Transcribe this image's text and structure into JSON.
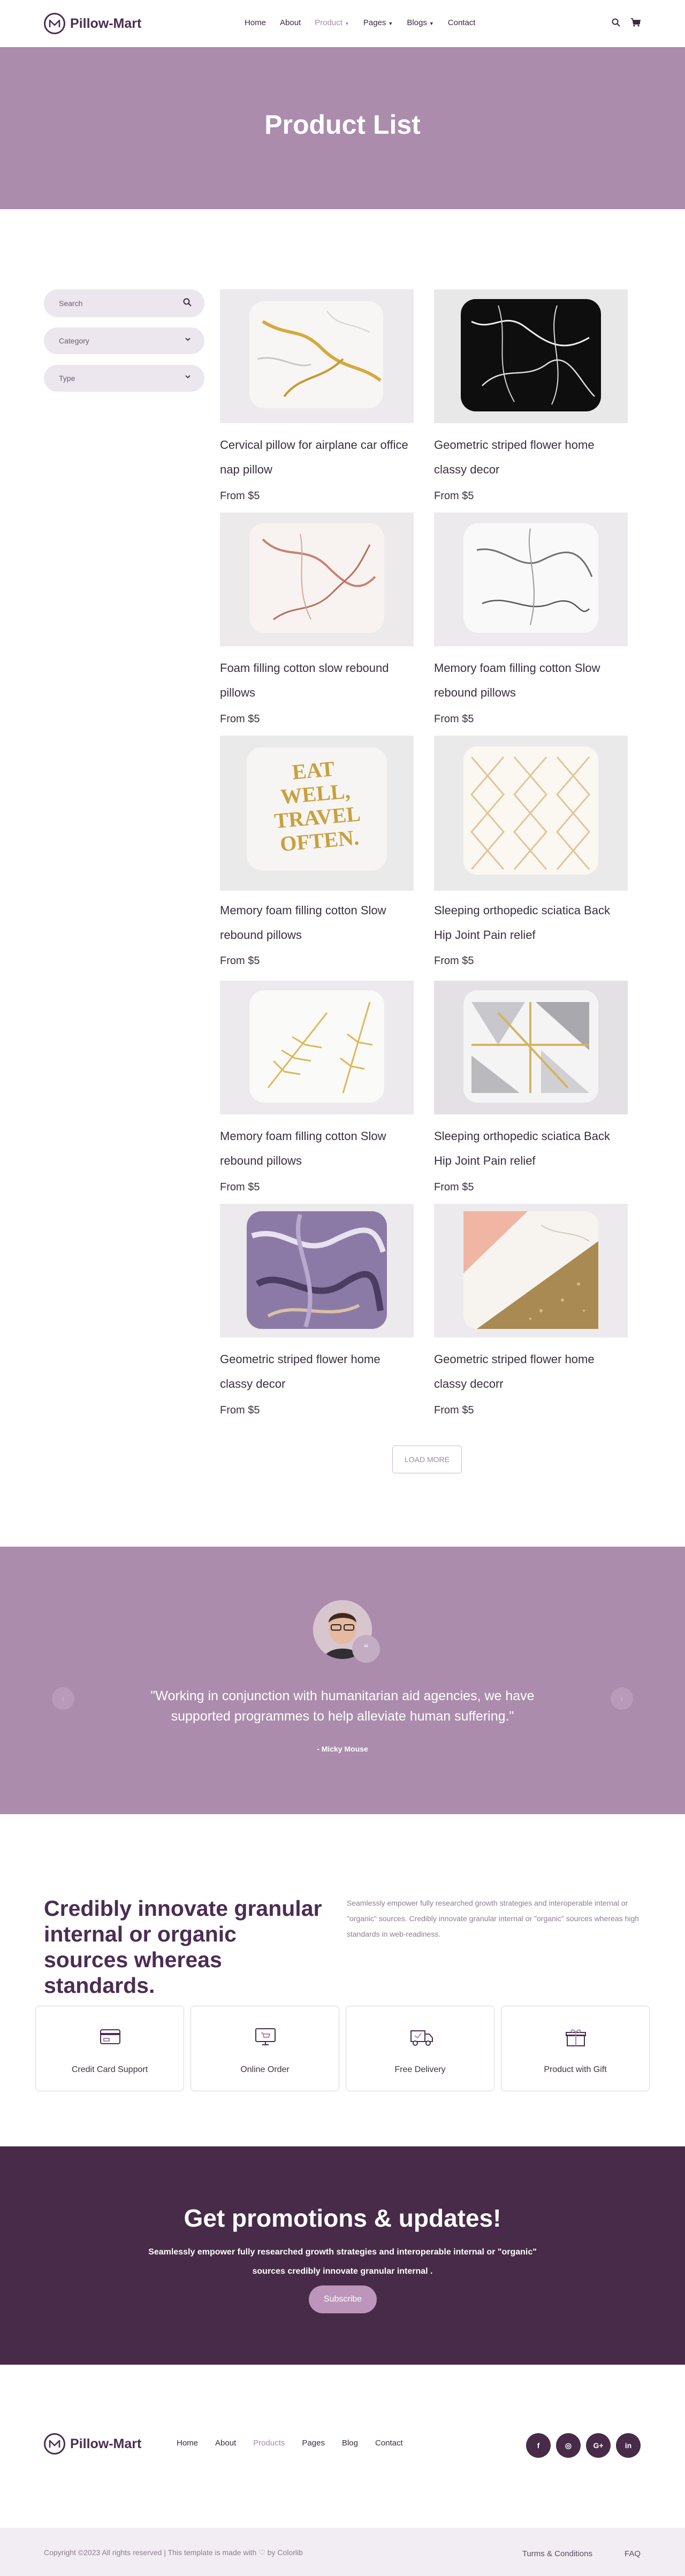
{
  "brand": {
    "name": "Pillow-Mart",
    "accent": "#ab8cac",
    "dark": "#472b48"
  },
  "nav": {
    "items": [
      {
        "label": "Home"
      },
      {
        "label": "About"
      },
      {
        "label": "Product",
        "active": true,
        "dropdown": true
      },
      {
        "label": "Pages",
        "dropdown": true
      },
      {
        "label": "Blogs",
        "dropdown": true
      },
      {
        "label": "Contact"
      }
    ],
    "icons": [
      "search-icon",
      "cart-icon"
    ]
  },
  "hero": {
    "title": "Product List"
  },
  "filters": {
    "search_placeholder": "Search",
    "category_label": "Category",
    "type_label": "Type"
  },
  "products": [
    {
      "title": "Cervical pillow for airplane car office nap pillow",
      "price": "From $5"
    },
    {
      "title": "Geometric striped flower home classy decor",
      "price": "From $5"
    },
    {
      "title": "Foam filling cotton slow rebound pillows",
      "price": "From $5"
    },
    {
      "title": "Memory foam filling cotton Slow rebound pillows",
      "price": "From $5"
    },
    {
      "title": "Memory foam filling cotton Slow rebound pillows",
      "price": "From $5"
    },
    {
      "title": "Sleeping orthopedic sciatica Back Hip Joint Pain relief",
      "price": "From $5"
    },
    {
      "title": "Memory foam filling cotton Slow rebound pillows",
      "price": "From $5"
    },
    {
      "title": "Sleeping orthopedic sciatica Back Hip Joint Pain relief",
      "price": "From $5"
    },
    {
      "title": "Geometric striped flower home classy decor",
      "price": "From $5"
    },
    {
      "title": "Geometric striped flower home classy decorr",
      "price": "From $5"
    }
  ],
  "pillow_art": {
    "eat_well_lines": [
      "EAT",
      "WELL,",
      "TRAVEL",
      "OFTEN."
    ]
  },
  "load_more": "LOAD MORE",
  "testimonial": {
    "quote": "\"Working in conjunction with humanitarian aid agencies, we have supported programmes to help alleviate human suffering.\"",
    "author": "- Micky Mouse"
  },
  "features": {
    "heading": "Credibly innovate granular internal or organic sources whereas standards.",
    "text": "Seamlessly empower fully researched growth strategies and interoperable internal or \"organic\" sources. Credibly innovate granular internal or \"organic\" sources whereas high standards in web-readiness.",
    "items": [
      {
        "label": "Credit Card Support",
        "icon": "credit-card-icon"
      },
      {
        "label": "Online Order",
        "icon": "online-order-icon"
      },
      {
        "label": "Free Delivery",
        "icon": "delivery-truck-icon"
      },
      {
        "label": "Product with Gift",
        "icon": "gift-icon"
      }
    ]
  },
  "promo": {
    "title": "Get promotions & updates!",
    "text": "Seamlessly empower fully researched growth strategies and interoperable internal or \"organic\" sources credibly innovate granular internal .",
    "button": "Subscribe"
  },
  "footer": {
    "nav": [
      {
        "label": "Home"
      },
      {
        "label": "About"
      },
      {
        "label": "Products",
        "active": true
      },
      {
        "label": "Pages"
      },
      {
        "label": "Blog"
      },
      {
        "label": "Contact"
      }
    ],
    "social": [
      {
        "label": "f",
        "icon": "facebook-icon"
      },
      {
        "label": "◎",
        "icon": "instagram-icon"
      },
      {
        "label": "G+",
        "icon": "google-plus-icon"
      },
      {
        "label": "in",
        "icon": "linkedin-icon"
      }
    ],
    "copyright": "Copyright ©2023 All rights reserved | This template is made with ♡ by Colorlib",
    "links": [
      "Turms & Conditions",
      "FAQ"
    ]
  }
}
